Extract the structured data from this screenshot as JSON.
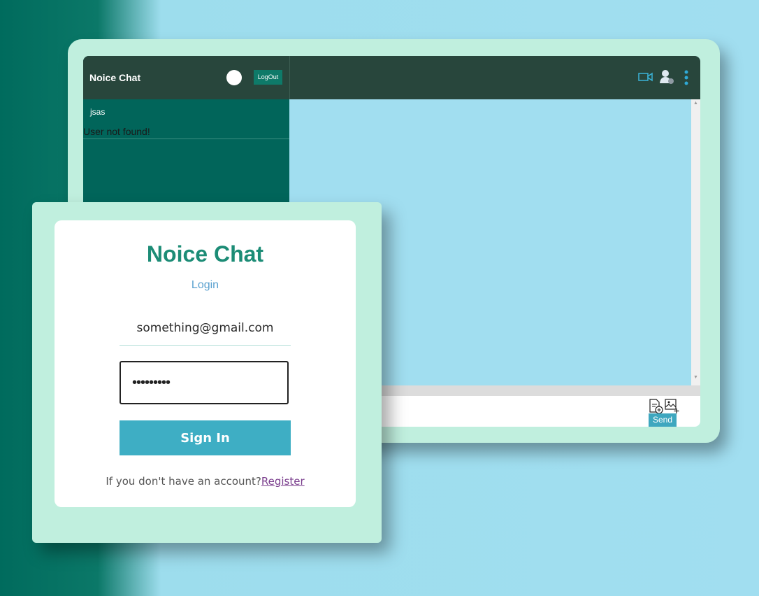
{
  "chat": {
    "app_title": "Noice Chat",
    "logout_label": "LogOut",
    "search_value": "jsas",
    "search_result": "User not found!",
    "send_label": "Send",
    "icons": [
      "video-call-icon",
      "add-user-icon",
      "more-vertical-icon",
      "attach-file-icon",
      "attach-image-icon"
    ],
    "accent_color": "#3ea7bf",
    "header_color": "#28463c",
    "sidebar_color": "#01655a"
  },
  "login": {
    "title": "Noice Chat",
    "subtitle": "Login",
    "email_value": "something@gmail.com",
    "password_value": "•••••••••",
    "signin_label": "Sign In",
    "no_account_text": "If you don't have an account?",
    "register_label": "Register",
    "title_color": "#1c8c76",
    "button_color": "#3eaec4"
  }
}
